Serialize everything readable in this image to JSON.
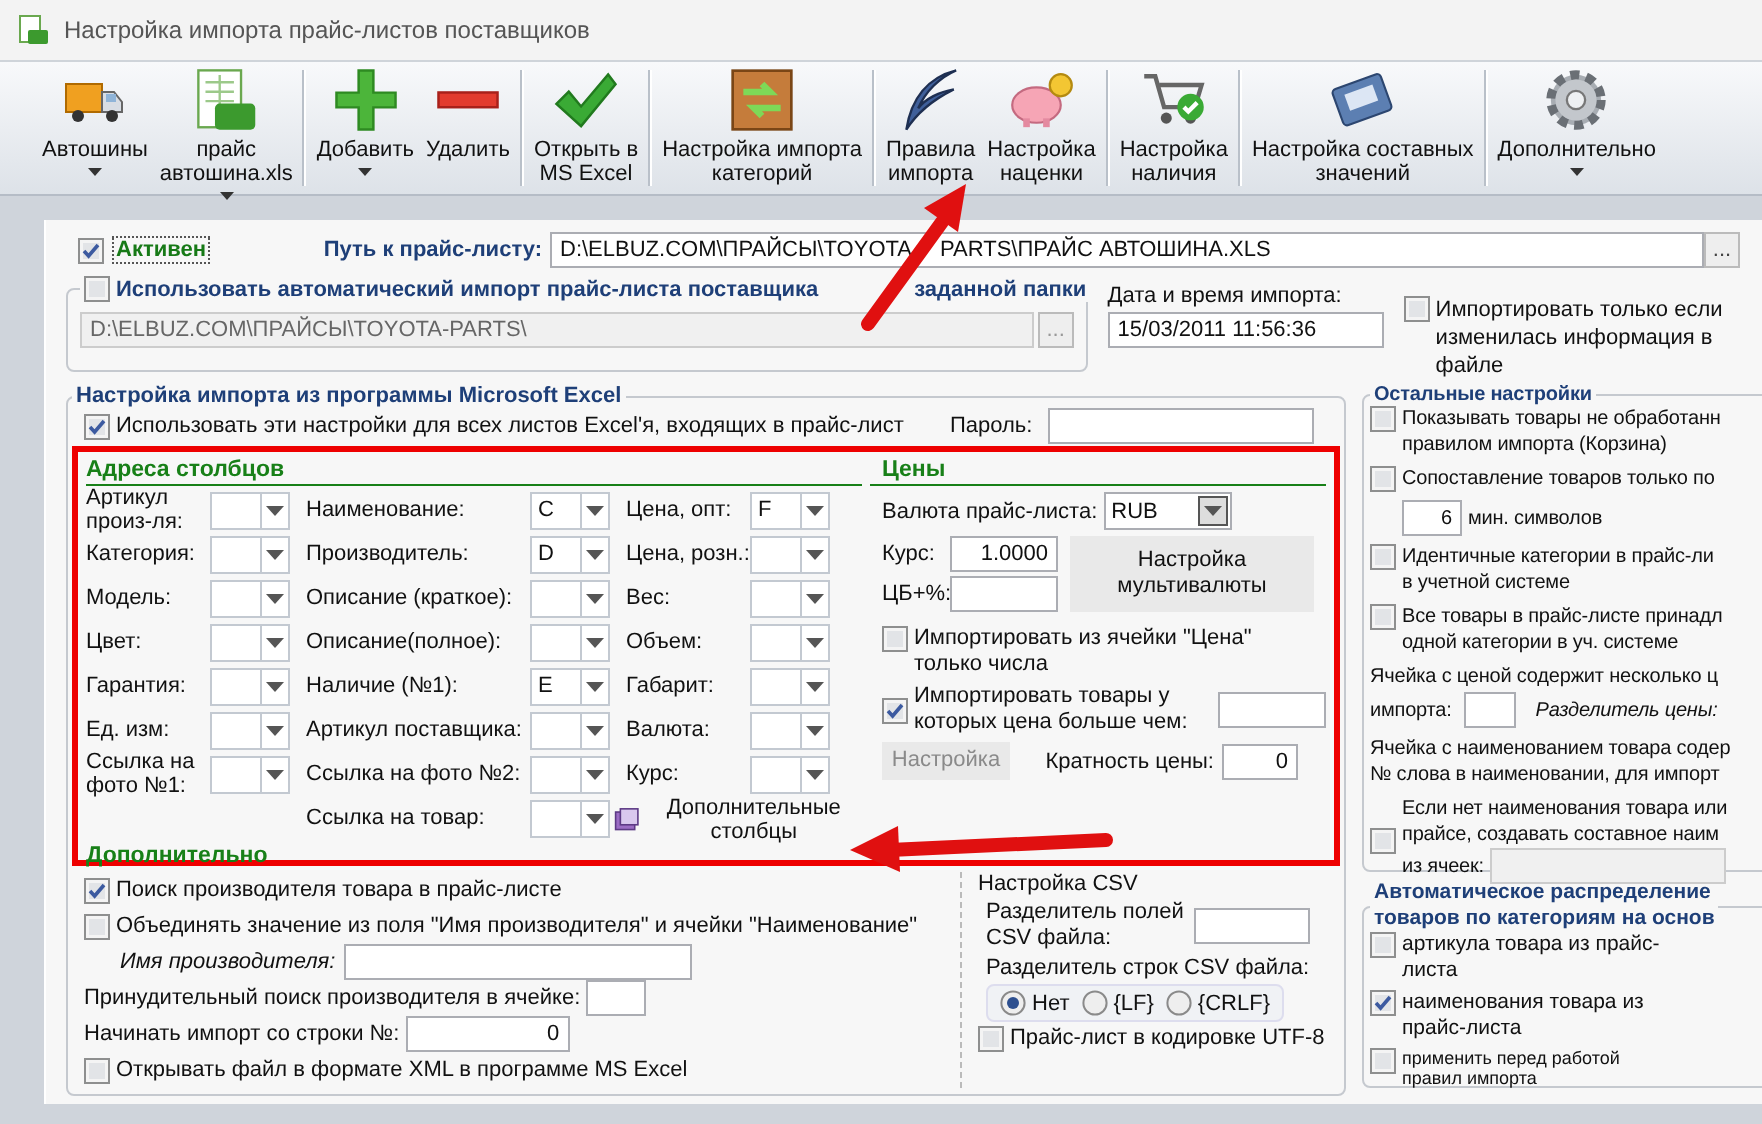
{
  "window": {
    "title": "Настройка импорта прайс-листов поставщиков"
  },
  "toolbar": {
    "groups": [
      [
        {
          "label": "Автошины",
          "dropdown": true
        },
        {
          "label": "прайс\nавтошина.xls",
          "dropdown": true
        }
      ],
      [
        {
          "label": "Добавить",
          "dropdown": true
        },
        {
          "label": "Удалить",
          "dropdown": false
        }
      ],
      [
        {
          "label": "Открыть в\nMS Excel",
          "dropdown": false
        }
      ],
      [
        {
          "label": "Настройка импорта\nкатегорий",
          "dropdown": false
        }
      ],
      [
        {
          "label": "Правила\nимпорта",
          "dropdown": false
        },
        {
          "label": "Настройка\nнаценки",
          "dropdown": false
        }
      ],
      [
        {
          "label": "Настройка\nналичия",
          "dropdown": false
        }
      ],
      [
        {
          "label": "Настройка составных\nзначений",
          "dropdown": false
        }
      ],
      [
        {
          "label": "Дополнительно",
          "dropdown": true
        }
      ]
    ]
  },
  "source": {
    "active": {
      "label": "Активен",
      "checked": true
    },
    "path_label": "Путь к прайс-листу:",
    "path_parts": [
      "D:\\ELBUZ.COM\\ПРАЙСЫ\\TOYOTA",
      "PARTS\\ПРАЙС АВТОШИНА.XLS"
    ],
    "browse": "...",
    "auto_import": {
      "label_start": "Использовать автоматический импорт прайс-листа поставщика",
      "label_end": "заданной папки",
      "checked": false,
      "folder": "D:\\ELBUZ.COM\\ПРАЙСЫ\\TOYOTA-PARTS\\",
      "browse": "..."
    },
    "date_label": "Дата и время импорта:",
    "date": "15/03/2011 11:56:36",
    "only_changed": {
      "label": "Импортировать только если изменилась информация в файле",
      "checked": false
    }
  },
  "excel": {
    "title": "Настройка импорта из программы Microsoft Excel",
    "all_sheets": {
      "label": "Использовать эти настройки для всех листов Excel'я, входящих в прайс-лист",
      "checked": true
    },
    "password_label": "Пароль:",
    "columns_title": "Адреса столбцов",
    "columns": [
      [
        {
          "label": "Артикул произ-ля:"
        },
        {
          "label": "Категория:"
        },
        {
          "label": "Модель:"
        },
        {
          "label": "Цвет:"
        },
        {
          "label": "Гарантия:"
        },
        {
          "label": "Ед. изм:"
        },
        {
          "label": "Ссылка на фото №1:"
        }
      ],
      [
        {
          "label": "Наименование:",
          "value": "C"
        },
        {
          "label": "Производитель:",
          "value": "D"
        },
        {
          "label": "Описание (краткое):"
        },
        {
          "label": "Описание(полное):"
        },
        {
          "label": "Наличие (№1):",
          "value": "E"
        },
        {
          "label": "Артикул поставщика:"
        },
        {
          "label": "Ссылка на фото №2:"
        },
        {
          "label": "Ссылка на товар:"
        }
      ],
      [
        {
          "label": "Цена, опт:",
          "value": "F"
        },
        {
          "label": "Цена, розн.:"
        },
        {
          "label": "Вес:"
        },
        {
          "label": "Объем:"
        },
        {
          "label": "Габарит:"
        },
        {
          "label": "Валюта:"
        },
        {
          "label": "Курс:"
        }
      ]
    ],
    "extra_columns": "Дополнительные столбцы",
    "prices": {
      "title": "Цены",
      "currency_label": "Валюта прайс-листа:",
      "currency": "RUB",
      "rate_label": "Курс:",
      "rate": "1.0000",
      "cb_label": "ЦБ+%:",
      "multicurrency": "Настройка мультивалюты",
      "only_numbers": {
        "label": "Импортировать из ячейки \"Цена\" только числа",
        "checked": false
      },
      "min_price": {
        "label": "Импортировать товары у которых цена больше чем:",
        "checked": true
      },
      "setup": {
        "label": "Настройка",
        "disabled": true
      },
      "multiple_label": "Кратность цены:",
      "multiple": "0"
    },
    "extra_title": "Дополнительно",
    "options": [
      {
        "label": "Поиск производителя товара в прайс-листе",
        "checked": true
      },
      {
        "label": "Объединять значение из поля \"Имя производителя\" и ячейки \"Наименование\"",
        "checked": false
      }
    ],
    "maker_name_label": "Имя производителя:",
    "forced_search_label": "Принудительный поиск производителя в ячейке:",
    "start_row_label": "Начинать импорт со строки №:",
    "start_row": "0",
    "xml": {
      "label": "Открывать файл в формате XML в программе MS Excel",
      "checked": false
    },
    "csv": {
      "title": "Настройка CSV",
      "field_sep_label": "Разделитель полей CSV файла:",
      "row_sep_label": "Разделитель строк CSV файла:",
      "row_sep": [
        {
          "label": "Нет",
          "selected": true
        },
        {
          "label": "{LF}",
          "selected": false
        },
        {
          "label": "{CRLF}",
          "selected": false
        }
      ],
      "utf8": {
        "label": "Прайс-лист в кодировке UTF-8",
        "checked": false
      }
    }
  },
  "other": {
    "title": "Остальные настройки",
    "items": [
      {
        "kind": "check",
        "lines": [
          "Показывать товары не обработанн",
          "правилом импорта (Корзина)"
        ],
        "checked": false
      },
      {
        "kind": "check",
        "lines": [
          "Сопоставление товаров только по"
        ],
        "checked": false
      },
      {
        "kind": "spin",
        "value": "6",
        "label": "мин. символов"
      },
      {
        "kind": "check",
        "lines": [
          "Идентичные категории в прайс-ли",
          "в учетной системе"
        ],
        "checked": false
      },
      {
        "kind": "check",
        "lines": [
          "Все товары в прайс-листе принадл",
          "одной категории в уч. системе"
        ],
        "checked": false
      },
      {
        "kind": "text",
        "lines": [
          "Ячейка с ценой содержит несколько ц"
        ]
      },
      {
        "kind": "split",
        "label": "импорта:",
        "note": "Разделитель цены:"
      },
      {
        "kind": "text",
        "lines": [
          "Ячейка с наименованием товара содер",
          "№ слова в наименовании, для импорт"
        ]
      },
      {
        "kind": "compose",
        "lines": [
          "Если нет наименования товара или",
          "прайсе, создавать составное наим"
        ],
        "field_label": "из ячеек:",
        "checked": false
      }
    ]
  },
  "auto": {
    "title_lines": [
      "Автоматическое распределение",
      "товаров по категориям на основ"
    ],
    "items": [
      {
        "label": "артикула товара из прайс-листа",
        "checked": false,
        "kind": "normal"
      },
      {
        "label": "наименования товара из прайс-листа",
        "checked": true,
        "kind": "normal"
      },
      {
        "label": "применить перед работой правил импорта",
        "checked": false,
        "kind": "small"
      }
    ]
  }
}
